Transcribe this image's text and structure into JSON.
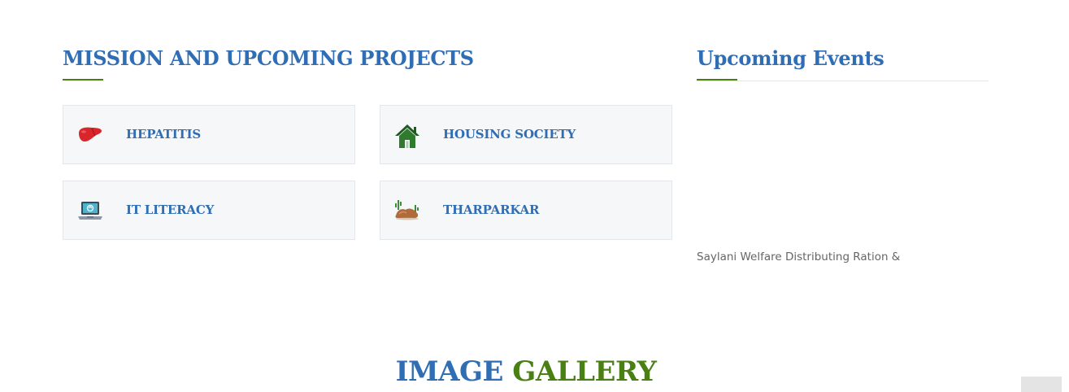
{
  "mission": {
    "title": "MISSION AND UPCOMING PROJECTS",
    "projects": [
      {
        "label": "HEPATITIS",
        "icon": "liver-icon"
      },
      {
        "label": "HOUSING SOCIETY",
        "icon": "house-icon"
      },
      {
        "label": "IT LITERACY",
        "icon": "laptop-icon"
      },
      {
        "label": "THARPARKAR",
        "icon": "desert-cactus-icon"
      }
    ]
  },
  "events": {
    "title": "Upcoming Events",
    "items": [
      {
        "text": "Saylani Welfare Distributing Ration &"
      }
    ]
  },
  "gallery": {
    "title_part1": "IMAGE",
    "title_part2": "GALLERY"
  },
  "colors": {
    "heading_blue": "#2f6db5",
    "accent_green": "#4a7f14",
    "card_bg": "#f5f7f9"
  }
}
